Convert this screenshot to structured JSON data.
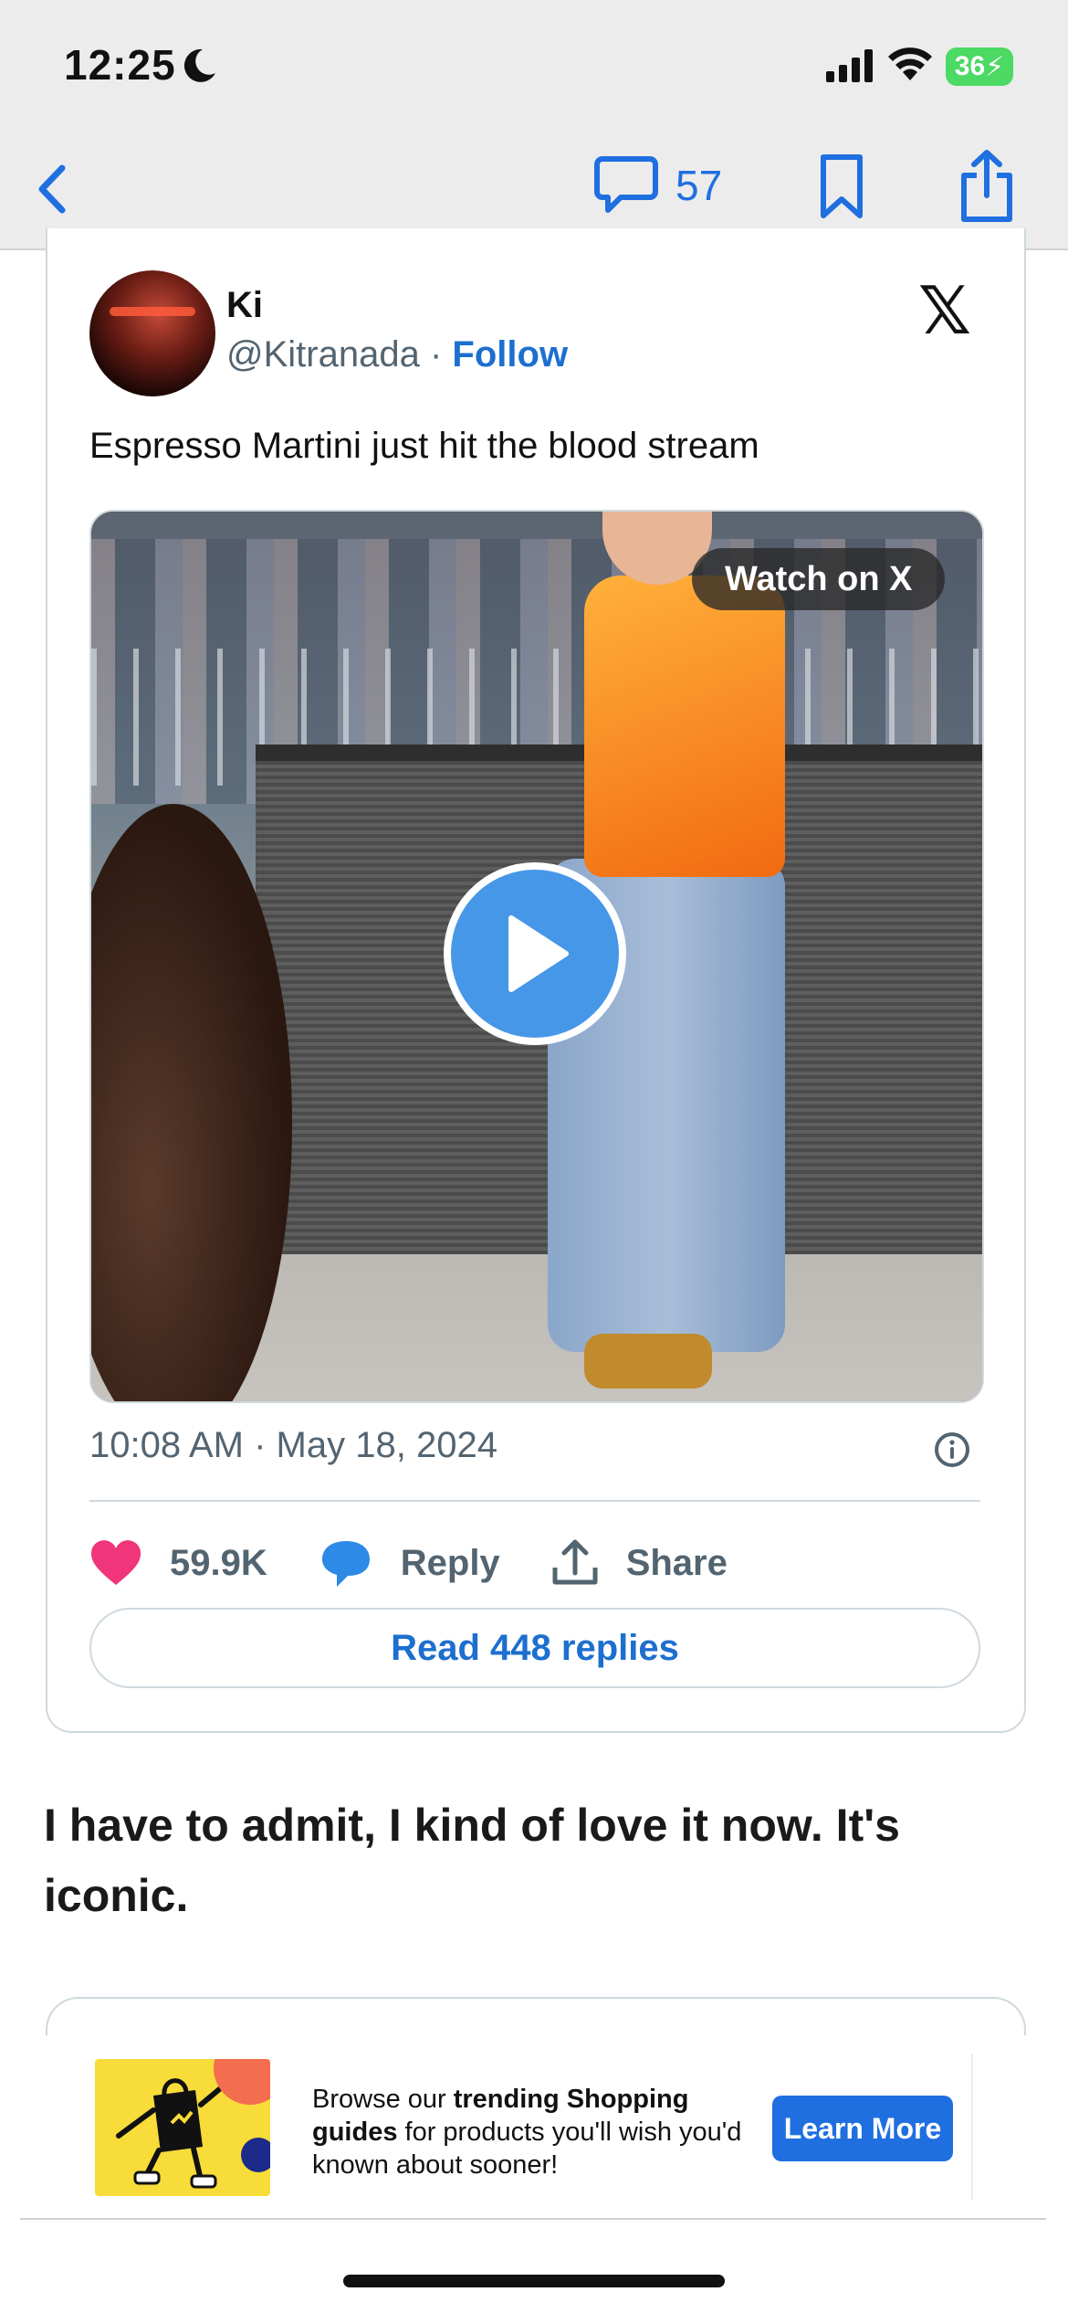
{
  "status_bar": {
    "time": "12:25",
    "battery": "36"
  },
  "nav": {
    "comment_count": "57"
  },
  "tweet": {
    "author_name": "Ki",
    "author_handle": "@Kitranada",
    "separator": "·",
    "follow_label": "Follow",
    "text": "Espresso Martini just hit the blood stream",
    "watch_label": "Watch on X",
    "timestamp": "10:08 AM · May 18, 2024",
    "likes": "59.9K",
    "reply_label": "Reply",
    "share_label": "Share",
    "read_replies_label": "Read 448 replies"
  },
  "article": {
    "paragraph": "I have to admit, I kind of love it now. It's iconic."
  },
  "ad": {
    "text_prefix": "Browse our ",
    "text_bold1": "trending Shopping guides",
    "text_suffix": " for products you'll wish you'd known about sooner!",
    "button_label": "Learn More"
  },
  "colors": {
    "accent": "#1f6fe0",
    "like": "#f0357a",
    "reply": "#2d8ae6"
  },
  "icons": [
    "moon-icon",
    "signal-icon",
    "wifi-icon",
    "back-chevron-icon",
    "comment-icon",
    "bookmark-icon",
    "share-icon",
    "x-logo-icon",
    "play-icon",
    "info-icon",
    "heart-icon",
    "reply-bubble-icon",
    "upload-icon"
  ]
}
